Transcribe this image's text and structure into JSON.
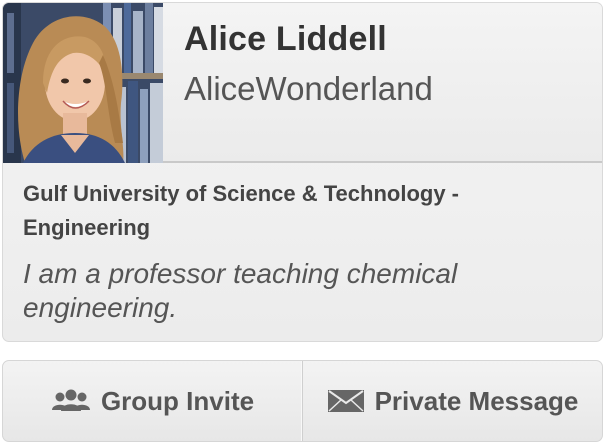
{
  "profile": {
    "name": "Alice Liddell",
    "username": "AliceWonderland",
    "organization": "Gulf University of Science & Technology - Engineering",
    "bio": "I am a professor teaching chemical engineering.",
    "avatar_icon": "profile-photo"
  },
  "actions": {
    "group_invite_label": "Group Invite",
    "group_invite_icon": "group-icon",
    "private_message_label": "Private Message",
    "private_message_icon": "envelope-icon"
  },
  "colors": {
    "text_primary": "#333333",
    "text_secondary": "#555555",
    "icon": "#666666"
  }
}
